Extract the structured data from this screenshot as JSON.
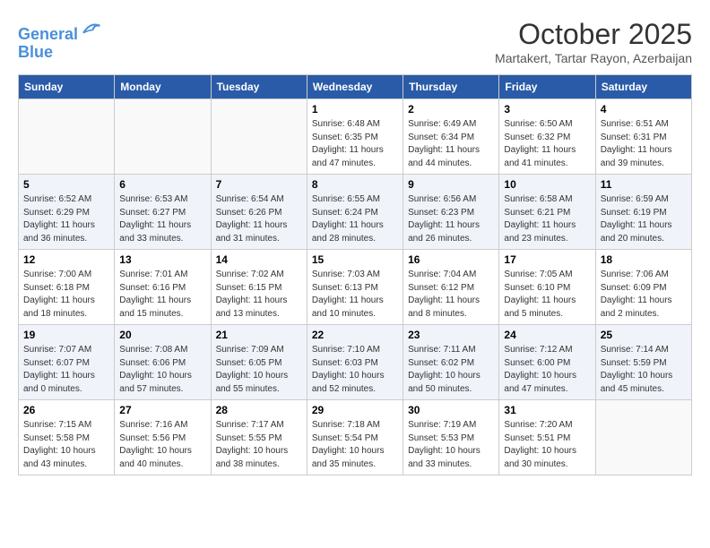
{
  "header": {
    "logo_line1": "General",
    "logo_line2": "Blue",
    "month_title": "October 2025",
    "subtitle": "Martakert, Tartar Rayon, Azerbaijan"
  },
  "days_of_week": [
    "Sunday",
    "Monday",
    "Tuesday",
    "Wednesday",
    "Thursday",
    "Friday",
    "Saturday"
  ],
  "weeks": [
    [
      {
        "day": "",
        "info": ""
      },
      {
        "day": "",
        "info": ""
      },
      {
        "day": "",
        "info": ""
      },
      {
        "day": "1",
        "info": "Sunrise: 6:48 AM\nSunset: 6:35 PM\nDaylight: 11 hours\nand 47 minutes."
      },
      {
        "day": "2",
        "info": "Sunrise: 6:49 AM\nSunset: 6:34 PM\nDaylight: 11 hours\nand 44 minutes."
      },
      {
        "day": "3",
        "info": "Sunrise: 6:50 AM\nSunset: 6:32 PM\nDaylight: 11 hours\nand 41 minutes."
      },
      {
        "day": "4",
        "info": "Sunrise: 6:51 AM\nSunset: 6:31 PM\nDaylight: 11 hours\nand 39 minutes."
      }
    ],
    [
      {
        "day": "5",
        "info": "Sunrise: 6:52 AM\nSunset: 6:29 PM\nDaylight: 11 hours\nand 36 minutes."
      },
      {
        "day": "6",
        "info": "Sunrise: 6:53 AM\nSunset: 6:27 PM\nDaylight: 11 hours\nand 33 minutes."
      },
      {
        "day": "7",
        "info": "Sunrise: 6:54 AM\nSunset: 6:26 PM\nDaylight: 11 hours\nand 31 minutes."
      },
      {
        "day": "8",
        "info": "Sunrise: 6:55 AM\nSunset: 6:24 PM\nDaylight: 11 hours\nand 28 minutes."
      },
      {
        "day": "9",
        "info": "Sunrise: 6:56 AM\nSunset: 6:23 PM\nDaylight: 11 hours\nand 26 minutes."
      },
      {
        "day": "10",
        "info": "Sunrise: 6:58 AM\nSunset: 6:21 PM\nDaylight: 11 hours\nand 23 minutes."
      },
      {
        "day": "11",
        "info": "Sunrise: 6:59 AM\nSunset: 6:19 PM\nDaylight: 11 hours\nand 20 minutes."
      }
    ],
    [
      {
        "day": "12",
        "info": "Sunrise: 7:00 AM\nSunset: 6:18 PM\nDaylight: 11 hours\nand 18 minutes."
      },
      {
        "day": "13",
        "info": "Sunrise: 7:01 AM\nSunset: 6:16 PM\nDaylight: 11 hours\nand 15 minutes."
      },
      {
        "day": "14",
        "info": "Sunrise: 7:02 AM\nSunset: 6:15 PM\nDaylight: 11 hours\nand 13 minutes."
      },
      {
        "day": "15",
        "info": "Sunrise: 7:03 AM\nSunset: 6:13 PM\nDaylight: 11 hours\nand 10 minutes."
      },
      {
        "day": "16",
        "info": "Sunrise: 7:04 AM\nSunset: 6:12 PM\nDaylight: 11 hours\nand 8 minutes."
      },
      {
        "day": "17",
        "info": "Sunrise: 7:05 AM\nSunset: 6:10 PM\nDaylight: 11 hours\nand 5 minutes."
      },
      {
        "day": "18",
        "info": "Sunrise: 7:06 AM\nSunset: 6:09 PM\nDaylight: 11 hours\nand 2 minutes."
      }
    ],
    [
      {
        "day": "19",
        "info": "Sunrise: 7:07 AM\nSunset: 6:07 PM\nDaylight: 11 hours\nand 0 minutes."
      },
      {
        "day": "20",
        "info": "Sunrise: 7:08 AM\nSunset: 6:06 PM\nDaylight: 10 hours\nand 57 minutes."
      },
      {
        "day": "21",
        "info": "Sunrise: 7:09 AM\nSunset: 6:05 PM\nDaylight: 10 hours\nand 55 minutes."
      },
      {
        "day": "22",
        "info": "Sunrise: 7:10 AM\nSunset: 6:03 PM\nDaylight: 10 hours\nand 52 minutes."
      },
      {
        "day": "23",
        "info": "Sunrise: 7:11 AM\nSunset: 6:02 PM\nDaylight: 10 hours\nand 50 minutes."
      },
      {
        "day": "24",
        "info": "Sunrise: 7:12 AM\nSunset: 6:00 PM\nDaylight: 10 hours\nand 47 minutes."
      },
      {
        "day": "25",
        "info": "Sunrise: 7:14 AM\nSunset: 5:59 PM\nDaylight: 10 hours\nand 45 minutes."
      }
    ],
    [
      {
        "day": "26",
        "info": "Sunrise: 7:15 AM\nSunset: 5:58 PM\nDaylight: 10 hours\nand 43 minutes."
      },
      {
        "day": "27",
        "info": "Sunrise: 7:16 AM\nSunset: 5:56 PM\nDaylight: 10 hours\nand 40 minutes."
      },
      {
        "day": "28",
        "info": "Sunrise: 7:17 AM\nSunset: 5:55 PM\nDaylight: 10 hours\nand 38 minutes."
      },
      {
        "day": "29",
        "info": "Sunrise: 7:18 AM\nSunset: 5:54 PM\nDaylight: 10 hours\nand 35 minutes."
      },
      {
        "day": "30",
        "info": "Sunrise: 7:19 AM\nSunset: 5:53 PM\nDaylight: 10 hours\nand 33 minutes."
      },
      {
        "day": "31",
        "info": "Sunrise: 7:20 AM\nSunset: 5:51 PM\nDaylight: 10 hours\nand 30 minutes."
      },
      {
        "day": "",
        "info": ""
      }
    ]
  ]
}
